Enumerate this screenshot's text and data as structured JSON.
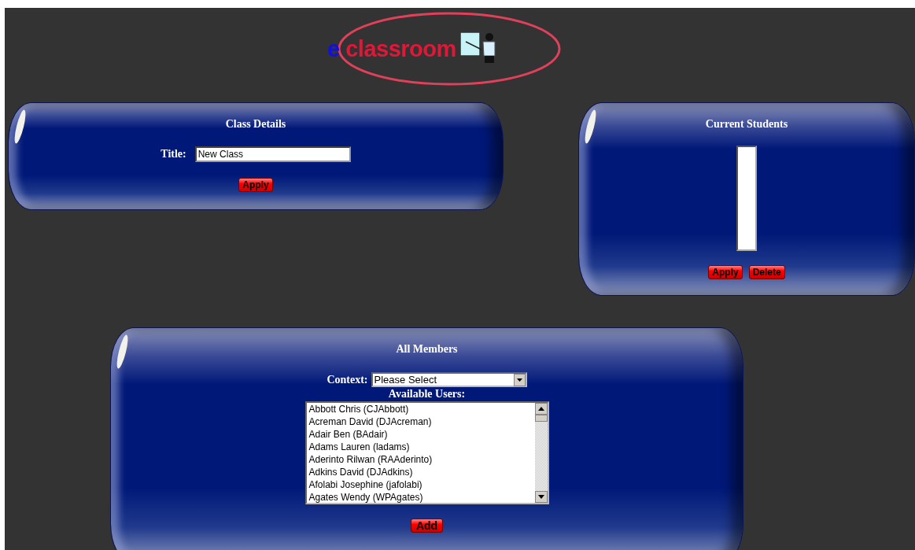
{
  "logo": {
    "prefix": "e",
    "name": "classroom"
  },
  "class_details": {
    "title": "Class Details",
    "field_label": "Title:",
    "field_value": "New Class",
    "button": "Apply"
  },
  "current_students": {
    "title": "Current Students",
    "buttons": [
      "Apply",
      "Delete"
    ]
  },
  "all_members": {
    "title": "All Members",
    "context_label": "Context:",
    "context_value": "Please Select",
    "users_label": "Available Users:",
    "users": [
      "Abbott Chris (CJAbbott)",
      "Acreman David (DJAcreman)",
      "Adair Ben (BAdair)",
      "Adams Lauren (ladams)",
      "Aderinto Rilwan (RAAderinto)",
      "Adkins David (DJAdkins)",
      "Afolabi Josephine (jafolabi)",
      "Agates Wendy (WPAgates)"
    ],
    "button": "Add"
  }
}
